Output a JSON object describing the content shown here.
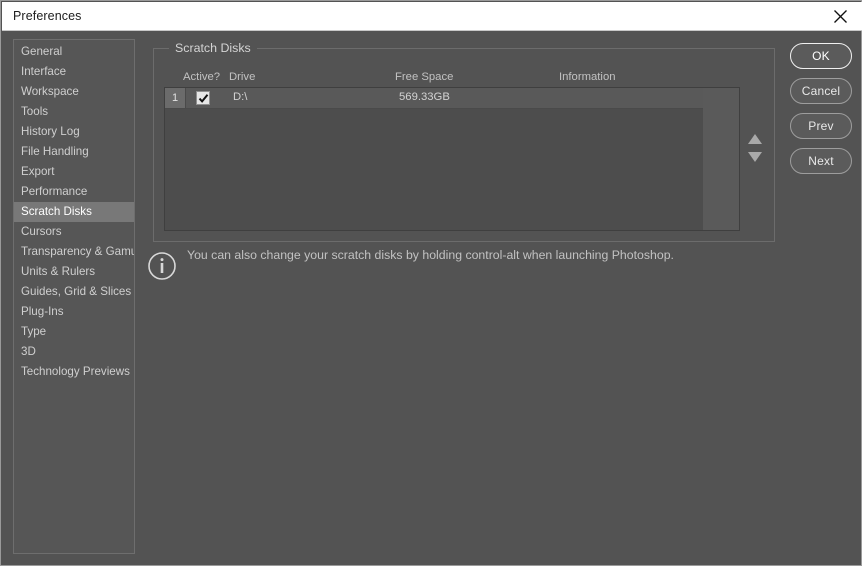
{
  "window": {
    "title": "Preferences",
    "close_icon": "close-icon",
    "bg_color": "#535353",
    "titlebar_color": "#ffffff"
  },
  "sidebar": {
    "selected": "Scratch Disks",
    "items": [
      {
        "label": "General"
      },
      {
        "label": "Interface"
      },
      {
        "label": "Workspace"
      },
      {
        "label": "Tools"
      },
      {
        "label": "History Log"
      },
      {
        "label": "File Handling"
      },
      {
        "label": "Export"
      },
      {
        "label": "Performance"
      },
      {
        "label": "Scratch Disks"
      },
      {
        "label": "Cursors"
      },
      {
        "label": "Transparency & Gamut"
      },
      {
        "label": "Units & Rulers"
      },
      {
        "label": "Guides, Grid & Slices"
      },
      {
        "label": "Plug-Ins"
      },
      {
        "label": "Type"
      },
      {
        "label": "3D"
      },
      {
        "label": "Technology Previews"
      }
    ]
  },
  "main": {
    "group_title": "Scratch Disks",
    "table": {
      "columns": [
        "Active?",
        "Drive",
        "Free Space",
        "Information"
      ],
      "rows": [
        {
          "number": "1",
          "active": true,
          "drive": "D:\\",
          "free_space": "569.33GB",
          "information": ""
        }
      ]
    },
    "scroll": {
      "up_icon": "arrow-up-icon",
      "down_icon": "arrow-down-icon"
    },
    "note": {
      "icon": "info-icon",
      "text": "You can also change your scratch disks by holding control-alt when launching Photoshop."
    }
  },
  "buttons": [
    {
      "label": "OK",
      "primary": true
    },
    {
      "label": "Cancel",
      "primary": false
    },
    {
      "label": "Prev",
      "primary": false
    },
    {
      "label": "Next",
      "primary": false
    }
  ]
}
